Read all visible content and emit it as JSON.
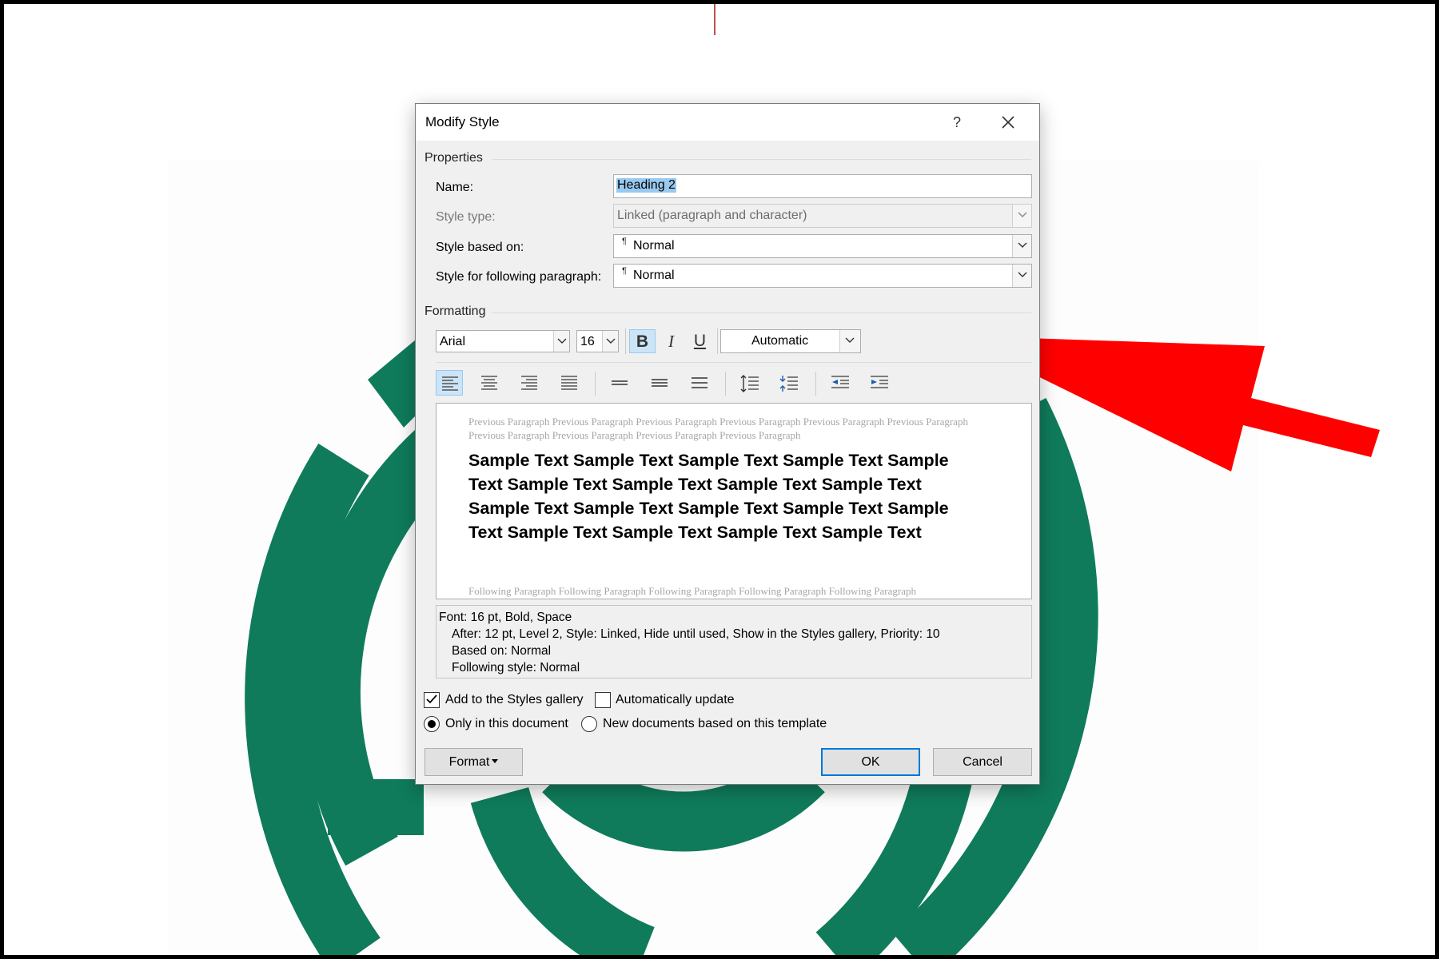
{
  "dialog": {
    "title": "Modify Style",
    "help": "?",
    "properties": {
      "section_label": "Properties",
      "name_label": "Name:",
      "name_value": "Heading 2",
      "style_type_label": "Style type:",
      "style_type_value": "Linked (paragraph and character)",
      "based_on_label": "Style based on:",
      "based_on_value": "Normal",
      "following_label": "Style for following paragraph:",
      "following_value": "Normal",
      "pilcrow": "¶"
    },
    "formatting": {
      "section_label": "Formatting",
      "font": "Arial",
      "size": "16",
      "bold": "B",
      "italic": "I",
      "underline": "U",
      "color": "Automatic",
      "bold_active": true,
      "alignment_active": "left"
    },
    "preview": {
      "previous_paragraph": "Previous Paragraph Previous Paragraph Previous Paragraph Previous Paragraph Previous Paragraph Previous Paragraph Previous Paragraph Previous Paragraph Previous Paragraph Previous Paragraph",
      "sample_text": "Sample Text Sample Text Sample Text Sample Text Sample Text Sample Text Sample Text Sample Text Sample Text Sample Text Sample Text Sample Text Sample Text Sample Text Sample Text Sample Text Sample Text Sample Text",
      "following_paragraph": "Following Paragraph Following Paragraph Following Paragraph Following Paragraph Following Paragraph"
    },
    "description": {
      "line1": "Font: 16 pt, Bold, Space",
      "line2": "After:  12 pt, Level 2, Style: Linked, Hide until used, Show in the Styles gallery, Priority: 10",
      "line3": "Based on: Normal",
      "line4": "Following style: Normal"
    },
    "options": {
      "add_to_gallery": "Add to the Styles gallery",
      "add_to_gallery_checked": true,
      "auto_update": "Automatically update",
      "auto_update_checked": false,
      "only_this_doc": "Only in this document",
      "new_docs": "New documents based on this template",
      "selected_scope": "only_this_doc"
    },
    "buttons": {
      "format": "Format",
      "ok": "OK",
      "cancel": "Cancel"
    }
  },
  "colors": {
    "logo_green": "#0f7b5a",
    "arrow_red": "#ff0000",
    "selection_blue": "#99c9ef",
    "default_button_border": "#0078d7"
  }
}
